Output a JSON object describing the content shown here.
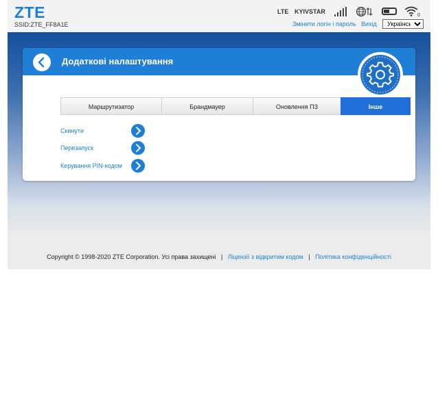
{
  "header": {
    "logo": "ZTE",
    "ssid": "SSID:ZTE_FF8A1E",
    "network_type": "LTE",
    "carrier": "KYIVSTAR",
    "change_login_link": "Змінити логін і пароль",
    "logout_link": "Вихід",
    "language": "Українська",
    "signal_bars": 5,
    "battery_level": 0.4,
    "wifi_clients": "0"
  },
  "panel": {
    "title": "Додаткові налаштування"
  },
  "tabs": [
    {
      "label": "Маршрутизатор",
      "active": false
    },
    {
      "label": "Брандмауер",
      "active": false
    },
    {
      "label": "Оновлення ПЗ",
      "active": false
    },
    {
      "label": "Інше",
      "active": true
    }
  ],
  "menu": [
    {
      "label": "Скинути"
    },
    {
      "label": "Перезапуск"
    },
    {
      "label": "Керування PIN-кодом"
    }
  ],
  "footer": {
    "copyright": "Copyright © 1998-2020 ZTE Corporation. Усі права захищені",
    "separator": "|",
    "opensource_link": "Ліцензії з відкритим кодом",
    "privacy_link": "Політика конфіденційності"
  },
  "colors": {
    "accent": "#1f7fd6",
    "header_bg": "#f3f3f3",
    "active_tab": "#1f6fd6"
  }
}
